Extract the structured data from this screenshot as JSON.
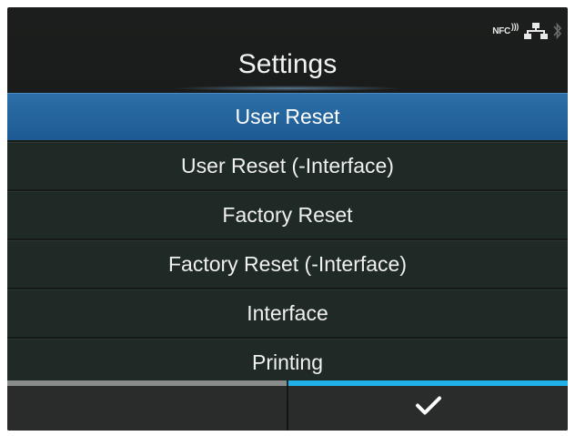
{
  "status": {
    "icons": [
      "nfc-icon",
      "lan-icon",
      "bluetooth-icon"
    ],
    "nfc_label": "NFC"
  },
  "title": "Settings",
  "menu": {
    "items": [
      {
        "label": "User Reset",
        "selected": true
      },
      {
        "label": "User Reset (-Interface)",
        "selected": false
      },
      {
        "label": "Factory Reset",
        "selected": false
      },
      {
        "label": "Factory Reset (-Interface)",
        "selected": false
      },
      {
        "label": "Interface",
        "selected": false
      },
      {
        "label": "Printing",
        "selected": false
      }
    ]
  },
  "softkeys": {
    "left": {
      "icon": "none"
    },
    "right": {
      "icon": "check-icon"
    }
  },
  "colors": {
    "selection": "#2d6fa8",
    "softkey_right_accent": "#1fb1e8",
    "softkey_left_accent": "#8a8c8b",
    "background": "#1a1c1b"
  }
}
